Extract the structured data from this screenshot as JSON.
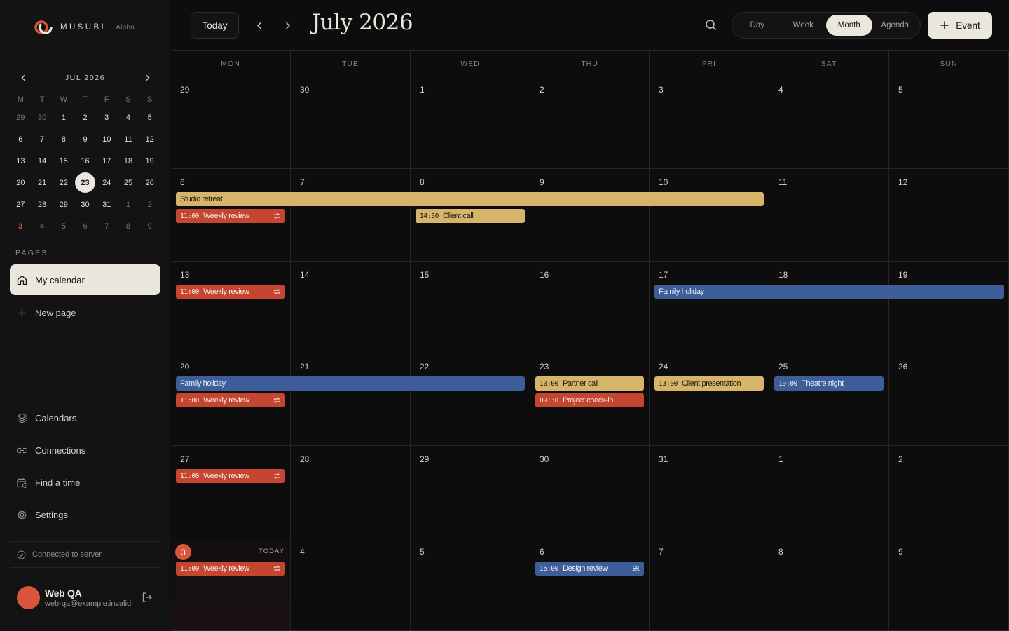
{
  "brand": {
    "name": "MUSUBI",
    "tag": "Alpha"
  },
  "mini_calendar": {
    "title": "JUL 2026",
    "weekdays": [
      "M",
      "T",
      "W",
      "T",
      "F",
      "S",
      "S"
    ],
    "weeks": [
      [
        "29",
        "30",
        "1",
        "2",
        "3",
        "4",
        "5"
      ],
      [
        "6",
        "7",
        "8",
        "9",
        "10",
        "11",
        "12"
      ],
      [
        "13",
        "14",
        "15",
        "16",
        "17",
        "18",
        "19"
      ],
      [
        "20",
        "21",
        "22",
        "23",
        "24",
        "25",
        "26"
      ],
      [
        "27",
        "28",
        "29",
        "30",
        "31",
        "1",
        "2"
      ],
      [
        "3",
        "4",
        "5",
        "6",
        "7",
        "8",
        "9"
      ]
    ],
    "selected": "23"
  },
  "sidebar": {
    "pages_label": "PAGES",
    "my_calendar": "My calendar",
    "new_page": "New page",
    "calendars": "Calendars",
    "connections": "Connections",
    "find_a_time": "Find a time",
    "settings": "Settings",
    "connection_status": "Connected to server"
  },
  "user": {
    "name": "Web QA",
    "email": "web-qa@example.invalid"
  },
  "header": {
    "today_label": "Today",
    "month_title": "July 2026",
    "views": [
      "Day",
      "Week",
      "Month",
      "Agenda"
    ],
    "active_view": "Month",
    "new_event_label": "Event"
  },
  "calendar": {
    "weekdays": [
      "MON",
      "TUE",
      "WED",
      "THU",
      "FRI",
      "SAT",
      "SUN"
    ],
    "weeks": [
      [
        "29",
        "30",
        "1",
        "2",
        "3",
        "4",
        "5"
      ],
      [
        "6",
        "7",
        "8",
        "9",
        "10",
        "11",
        "12"
      ],
      [
        "13",
        "14",
        "15",
        "16",
        "17",
        "18",
        "19"
      ],
      [
        "20",
        "21",
        "22",
        "23",
        "24",
        "25",
        "26"
      ],
      [
        "27",
        "28",
        "29",
        "30",
        "31",
        "1",
        "2"
      ],
      [
        "3",
        "4",
        "5",
        "6",
        "7",
        "8",
        "9"
      ]
    ],
    "today_label": "TODAY",
    "today_day": "3",
    "events": {
      "studio_retreat": {
        "title": "Studio retreat"
      },
      "weekly_review": {
        "time": "11:00",
        "title": "Weekly review"
      },
      "client_call": {
        "time": "14:30",
        "title": "Client call"
      },
      "family_holiday": {
        "title": "Family holiday"
      },
      "partner_call": {
        "time": "10:00",
        "title": "Partner call"
      },
      "project_checkin": {
        "time": "09:30",
        "title": "Project check-in"
      },
      "client_presentation": {
        "time": "13:00",
        "title": "Client presentation"
      },
      "theatre_night": {
        "time": "19:00",
        "title": "Theatre night"
      },
      "design_review": {
        "time": "16:00",
        "title": "Design review"
      }
    }
  },
  "colors": {
    "gold": "#d6b56a",
    "red": "#c54630",
    "blue": "#3d5e98",
    "accent": "#d9553c",
    "background": "#0e0d0e"
  }
}
